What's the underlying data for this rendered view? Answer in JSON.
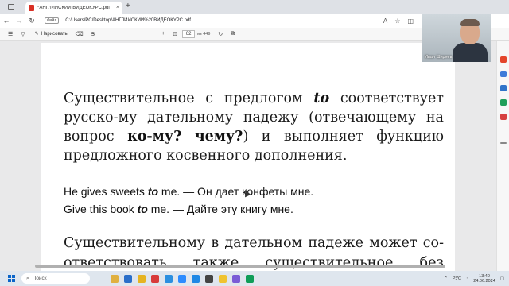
{
  "browser": {
    "tab_title": "*АНГЛИЙСКИЙ ВИДЕОКУРС.pdf",
    "tab_close": "×",
    "new_tab": "+",
    "file_chip": "Файл",
    "url": "C:/Users/PC/Desktop/АНГЛИЙСКИЙ%20ВИДЕОКУРС.pdf"
  },
  "pdf_toolbar": {
    "draw_label": "Нарисовать",
    "zoom_minus": "−",
    "zoom_plus": "+",
    "page_current": "62",
    "page_total": "из 449"
  },
  "webcam": {
    "name": "Иван Ширяев"
  },
  "document": {
    "para1_parts": {
      "a": "Существительное с предлогом ",
      "to": "to",
      "b": " соответствует русско-му дательному падежу (отвечающему на вопрос ",
      "q1": "ко-му?",
      "c": " ",
      "q2": "чему?",
      "d": ") и выполняет функцию предложного косвенного дополнения."
    },
    "example1": {
      "pre": "He gives sweets ",
      "to": "to",
      "post": " me. — Он дает конфеты мне."
    },
    "example2": {
      "pre": "Give this book ",
      "to": "to",
      "post": " me. — Дайте эту книгу мне."
    },
    "para2": "Существительному в дательном падеже может со-ответствовать также существительное без предлога, в"
  },
  "taskbar": {
    "search_placeholder": "Поиск",
    "lang": "РУС",
    "time": "13:40",
    "date": "24.06.2024"
  }
}
